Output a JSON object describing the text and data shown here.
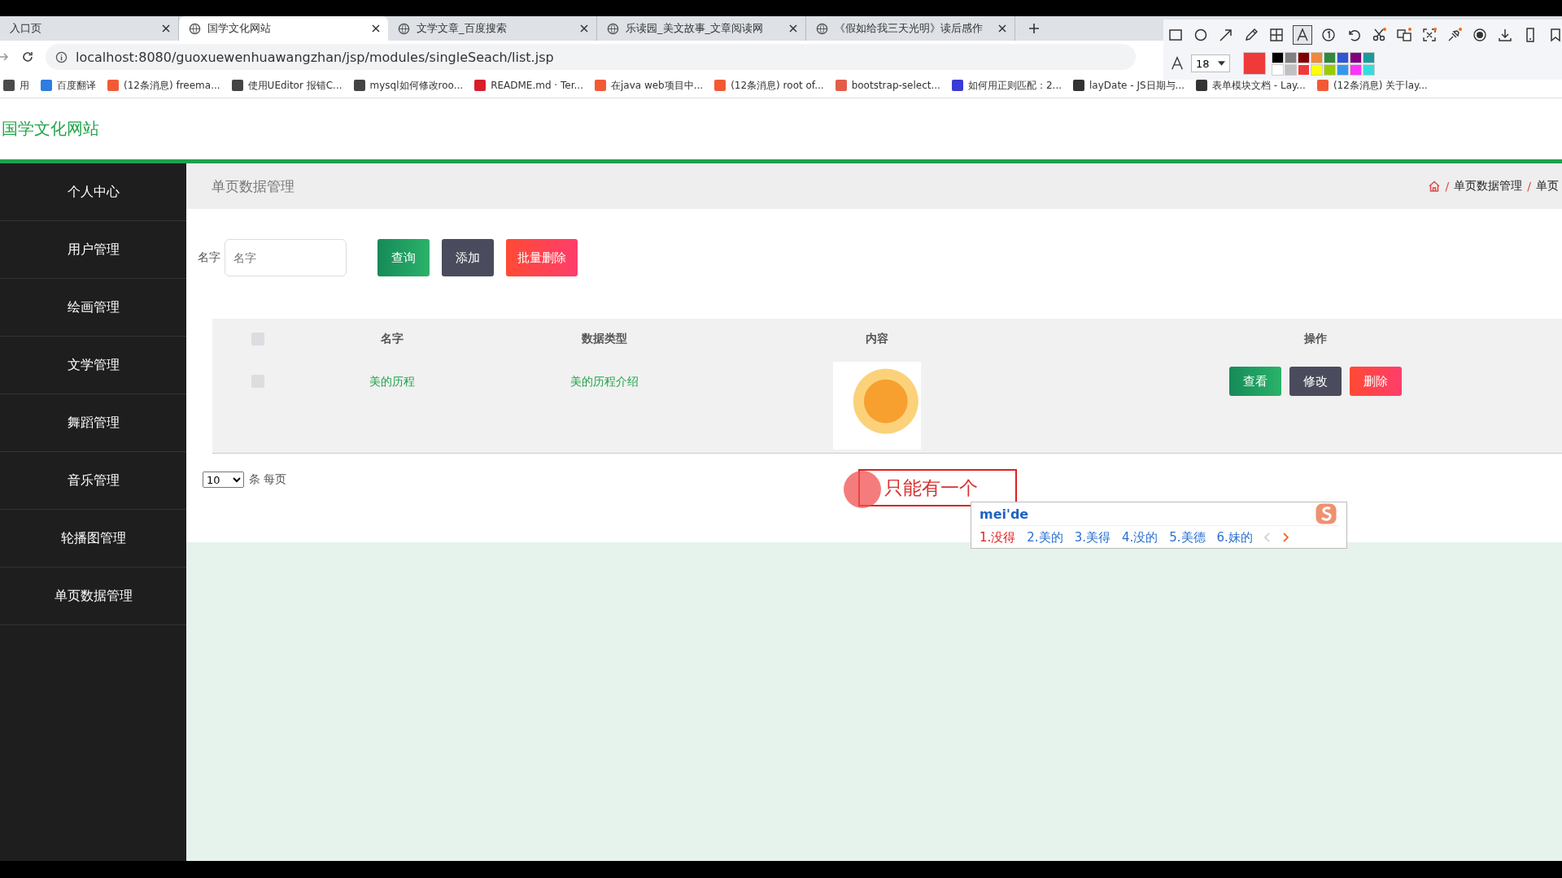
{
  "browser": {
    "tabs": [
      {
        "title": "入口页",
        "selected": false
      },
      {
        "title": "国学文化网站",
        "selected": true
      },
      {
        "title": "文学文章_百度搜索",
        "selected": false
      },
      {
        "title": "乐读园_美文故事_文章阅读网",
        "selected": false
      },
      {
        "title": "《假如给我三天光明》读后感作",
        "selected": false
      }
    ],
    "address": "localhost:8080/guoxuewenhuawangzhan/jsp/modules/singleSeach/list.jsp",
    "bookmarks": [
      {
        "label": "用",
        "color": "#4a4a4a"
      },
      {
        "label": "百度翻译",
        "color": "#2f7de1"
      },
      {
        "label": "(12条消息) freema...",
        "color": "#f25a36"
      },
      {
        "label": "使用UEditor 报错C...",
        "color": "#444444"
      },
      {
        "label": "mysql如何修改roo...",
        "color": "#444444"
      },
      {
        "label": "README.md · Ter...",
        "color": "#d81e2b"
      },
      {
        "label": "在java web项目中...",
        "color": "#f25a36"
      },
      {
        "label": "(12条消息) root of...",
        "color": "#f25a36"
      },
      {
        "label": "bootstrap-select...",
        "color": "#e35d4a"
      },
      {
        "label": "如何用正则匹配：2...",
        "color": "#3a3ad6"
      },
      {
        "label": "layDate - JS日期与...",
        "color": "#333333"
      },
      {
        "label": "表单模块文档 - Lay...",
        "color": "#333333"
      },
      {
        "label": "(12条消息) 关于lay...",
        "color": "#f25a36"
      }
    ]
  },
  "capture_toolbar": {
    "tools": [
      {
        "kind": "rect",
        "selected": false
      },
      {
        "kind": "circle",
        "selected": false
      },
      {
        "kind": "arrow",
        "selected": false
      },
      {
        "kind": "pencil",
        "selected": false
      },
      {
        "kind": "mosaic",
        "selected": false
      },
      {
        "kind": "text",
        "selected": true
      },
      {
        "kind": "number",
        "selected": false
      },
      {
        "kind": "undo",
        "selected": false
      },
      {
        "kind": "scissors",
        "selected": false
      },
      {
        "kind": "translate",
        "selected": false
      },
      {
        "kind": "crop",
        "selected": false
      },
      {
        "kind": "pin",
        "selected": false
      },
      {
        "kind": "record",
        "selected": false
      },
      {
        "kind": "download",
        "selected": false
      },
      {
        "kind": "phone",
        "selected": false
      },
      {
        "kind": "bookmark",
        "selected": false
      }
    ],
    "font_size": "18",
    "palette": [
      {
        "color": "#000000",
        "selected": false
      },
      {
        "color": "#808080",
        "selected": false
      },
      {
        "color": "#800000",
        "selected": false
      },
      {
        "color": "#f0883a",
        "selected": false
      },
      {
        "color": "#2e8b3a",
        "selected": false
      },
      {
        "color": "#3056d3",
        "selected": false
      },
      {
        "color": "#800080",
        "selected": false
      },
      {
        "color": "#1b9a9a",
        "selected": false
      },
      {
        "color": "#ffffff",
        "selected": false
      },
      {
        "color": "#c0c0c0",
        "selected": false
      },
      {
        "color": "#f03a3a",
        "selected": true
      },
      {
        "color": "#ffff00",
        "selected": false
      },
      {
        "color": "#99cc00",
        "selected": false
      },
      {
        "color": "#3399ee",
        "selected": false
      },
      {
        "color": "#ff33ff",
        "selected": false
      },
      {
        "color": "#33dddd",
        "selected": false
      }
    ]
  },
  "site": {
    "title": "国学文化网站"
  },
  "sidebar": {
    "items": [
      {
        "label": "个人中心"
      },
      {
        "label": "用户管理"
      },
      {
        "label": "绘画管理"
      },
      {
        "label": "文学管理"
      },
      {
        "label": "舞蹈管理"
      },
      {
        "label": "音乐管理"
      },
      {
        "label": "轮播图管理"
      },
      {
        "label": "单页数据管理"
      }
    ]
  },
  "page": {
    "heading": "单页数据管理",
    "separator": "/",
    "breadcrumb": [
      "单页数据管理",
      "单页"
    ]
  },
  "search": {
    "label": "名字",
    "placeholder": "名字",
    "buttons": [
      {
        "label": "查询",
        "kind": "primary"
      },
      {
        "label": "添加",
        "kind": "dark"
      },
      {
        "label": "批量删除",
        "kind": "danger"
      }
    ]
  },
  "table": {
    "all_checked": false,
    "columns": [
      "名字",
      "数据类型",
      "内容",
      "操作"
    ],
    "rows": [
      {
        "checked": false,
        "name": "美的历程",
        "type": "美的历程介绍",
        "actions": [
          {
            "label": "查看",
            "kind": "primary"
          },
          {
            "label": "修改",
            "kind": "dark"
          },
          {
            "label": "删除",
            "kind": "danger"
          }
        ]
      }
    ]
  },
  "pagination": {
    "page_size": "10",
    "suffix": "条 每页"
  },
  "annotation": {
    "text": "只能有一个"
  },
  "ime": {
    "input": "mei'de",
    "candidates": [
      {
        "label": "1.没得",
        "selected": true
      },
      {
        "label": "2.美的",
        "selected": false
      },
      {
        "label": "3.美得",
        "selected": false
      },
      {
        "label": "4.没的",
        "selected": false
      },
      {
        "label": "5.美德",
        "selected": false
      },
      {
        "label": "6.妹的",
        "selected": false
      }
    ]
  }
}
